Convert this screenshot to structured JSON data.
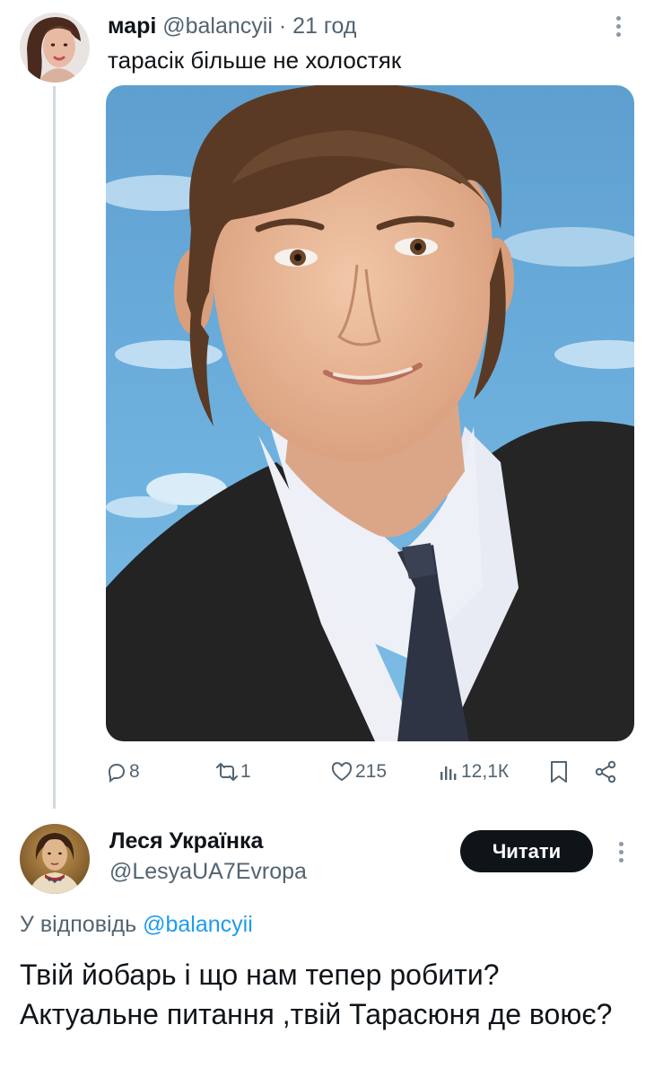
{
  "tweet": {
    "author_name": "марі",
    "author_handle": "@balancyii",
    "separator": "·",
    "time": "21 год",
    "text": "тарасік більше не холостяк",
    "image_alt": "photo of a young man in a dark suit and tie",
    "stats": {
      "replies": "8",
      "retweets": "1",
      "likes": "215",
      "views": "12,1К"
    },
    "icons": [
      "reply-icon",
      "retweet-icon",
      "like-icon",
      "views-icon",
      "bookmark-icon",
      "share-icon",
      "more-icon"
    ]
  },
  "reply": {
    "author_name": "Леся Українка",
    "author_handle": "@LesyaUA7Evropa",
    "follow_label": "Читати",
    "reply_prefix": "У відповідь",
    "reply_mention": "@balancyii",
    "text": "Твій йобарь і що нам тепер робити? Актуальне питання ,твій Тарасюня де воює?"
  },
  "colors": {
    "muted": "#536471",
    "link": "#1d9bf0",
    "thread_line": "#cfd9de",
    "button_bg": "#0f1419"
  }
}
